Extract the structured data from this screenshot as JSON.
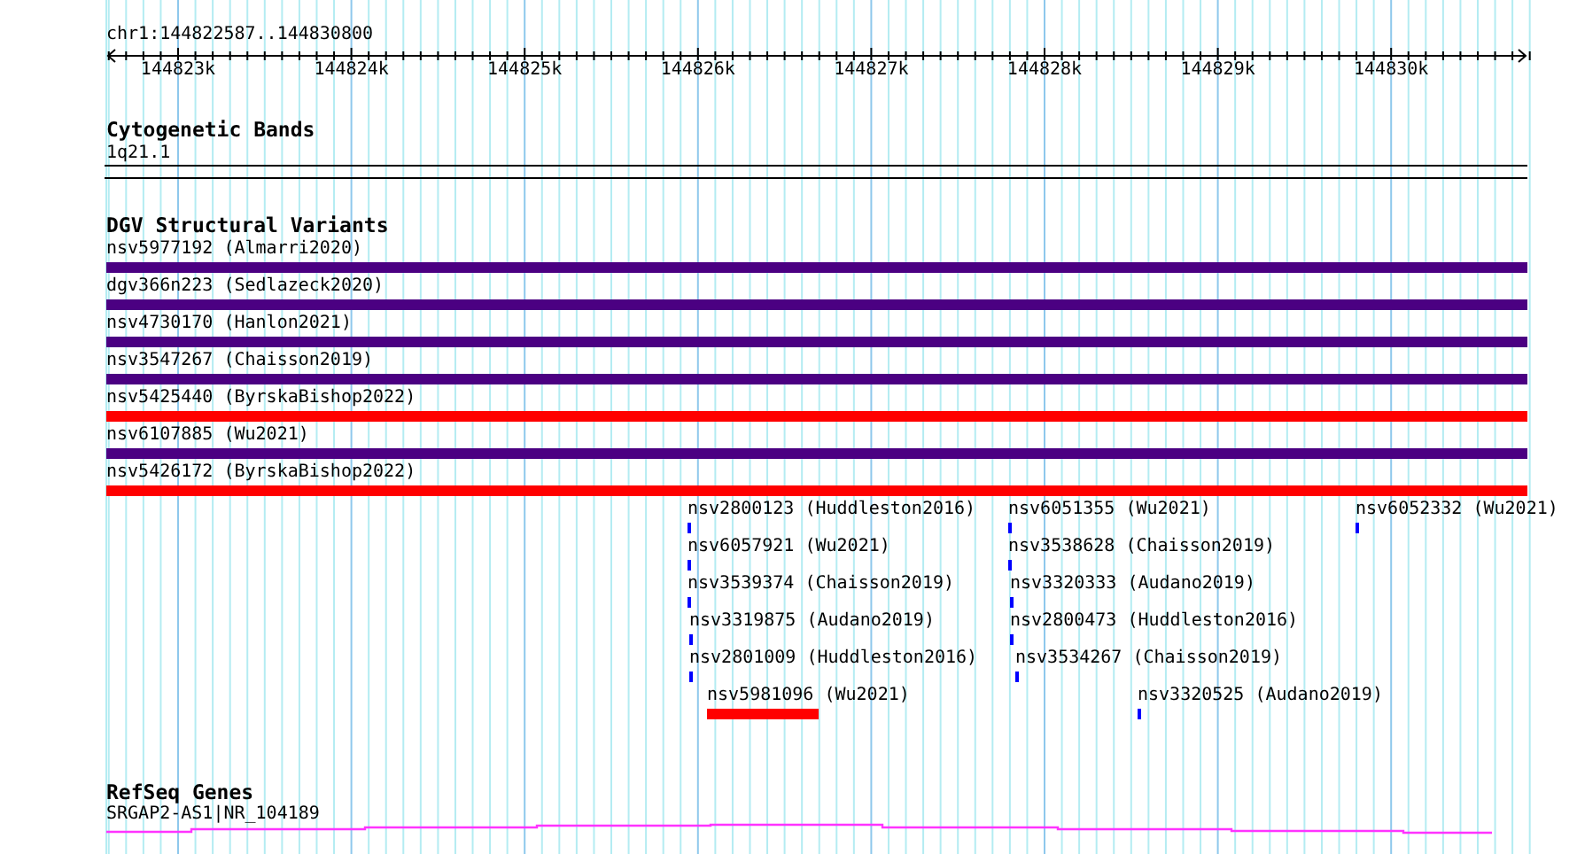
{
  "ruler": {
    "location": "chr1:144822587..144830800",
    "ticks": [
      "144823k",
      "144824k",
      "144825k",
      "144826k",
      "144827k",
      "144828k",
      "144829k",
      "144830k"
    ]
  },
  "cytogenetic_bands": {
    "title": "Cytogenetic Bands",
    "band": "1q21.1"
  },
  "dgv_structural_variants": {
    "title": "DGV Structural Variants",
    "features": [
      {
        "label": "nsv5977192 (Almarri2020)",
        "color": "#4b0082"
      },
      {
        "label": "dgv366n223 (Sedlazeck2020)",
        "color": "#4b0082"
      },
      {
        "label": "nsv4730170 (Hanlon2021)",
        "color": "#4b0082"
      },
      {
        "label": "nsv3547267 (Chaisson2019)",
        "color": "#4b0082"
      },
      {
        "label": "nsv5425440 (ByrskaBishop2022)",
        "color": "#ff0000"
      },
      {
        "label": "nsv6107885 (Wu2021)",
        "color": "#4b0082"
      },
      {
        "label": "nsv5426172 (ByrskaBishop2022)",
        "color": "#ff0000"
      },
      {
        "label": "nsv2800123 (Huddleston2016)",
        "color": "#0000ff"
      },
      {
        "label": "nsv6051355 (Wu2021)",
        "color": "#0000ff"
      },
      {
        "label": "nsv6052332 (Wu2021)",
        "color": "#0000ff"
      },
      {
        "label": "nsv6057921 (Wu2021)",
        "color": "#0000ff"
      },
      {
        "label": "nsv3538628 (Chaisson2019)",
        "color": "#0000ff"
      },
      {
        "label": "nsv3539374 (Chaisson2019)",
        "color": "#0000ff"
      },
      {
        "label": "nsv3320333 (Audano2019)",
        "color": "#0000ff"
      },
      {
        "label": "nsv3319875 (Audano2019)",
        "color": "#0000ff"
      },
      {
        "label": "nsv2800473 (Huddleston2016)",
        "color": "#0000ff"
      },
      {
        "label": "nsv2801009 (Huddleston2016)",
        "color": "#0000ff"
      },
      {
        "label": "nsv3534267 (Chaisson2019)",
        "color": "#0000ff"
      },
      {
        "label": "nsv5981096 (Wu2021)",
        "color": "#ff0000"
      },
      {
        "label": "nsv3320525 (Audano2019)",
        "color": "#0000ff"
      }
    ]
  },
  "refseq_genes": {
    "title": "RefSeq Genes",
    "gene": "SRGAP2-AS1|NR_104189"
  }
}
